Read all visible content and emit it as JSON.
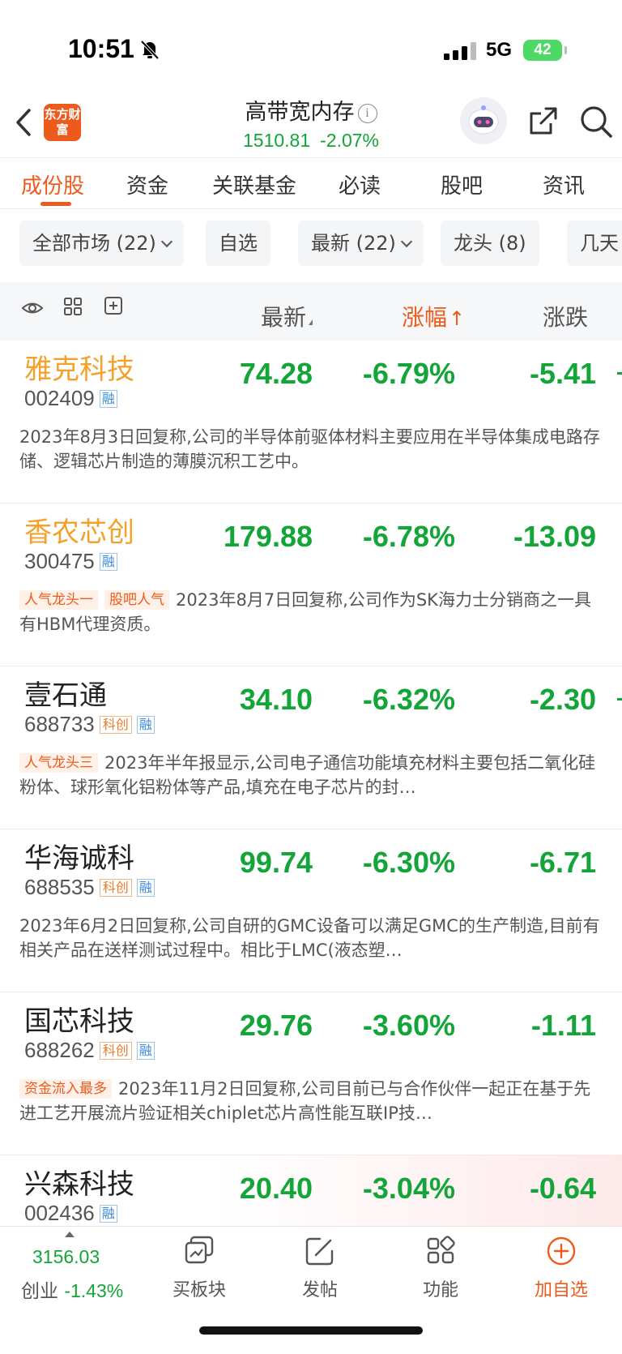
{
  "status": {
    "time": "10:51",
    "network": "5G",
    "battery": "42"
  },
  "header": {
    "logo_text": "东方财富",
    "title": "高带宽内存",
    "info_glyph": "i",
    "price": "1510.81",
    "change_pct": "-2.07%"
  },
  "tabs": [
    "成份股",
    "资金",
    "关联基金",
    "必读",
    "股吧",
    "资讯"
  ],
  "filters": [
    "全部市场 (22)",
    "自选",
    "最新 (22)",
    "龙头 (8)",
    "几天"
  ],
  "columns": {
    "latest": "最新",
    "pct": "涨幅",
    "pct_arrow": "↑",
    "change": "涨跌"
  },
  "stocks": [
    {
      "name": "雅克科技",
      "code": "002409",
      "badges": [
        "融"
      ],
      "price": "74.28",
      "pct": "-6.79%",
      "change": "-5.41",
      "tags": [],
      "desc": "2023年8月3日回复称,公司的半导体前驱体材料主要应用在半导体集成电路存储、逻辑芯片制造的薄膜沉积工艺中。"
    },
    {
      "name": "香农芯创",
      "code": "300475",
      "badges": [
        "融"
      ],
      "price": "179.88",
      "pct": "-6.78%",
      "change": "-13.09",
      "tags": [
        "人气龙头一",
        "股吧人气"
      ],
      "desc": "2023年8月7日回复称,公司作为SK海力士分销商之一具有HBM代理资质。"
    },
    {
      "name": "壹石通",
      "code": "688733",
      "badges": [
        "科创",
        "融"
      ],
      "price": "34.10",
      "pct": "-6.32%",
      "change": "-2.30",
      "tags": [
        "人气龙头三"
      ],
      "desc": "2023年半年报显示,公司电子通信功能填充材料主要包括二氧化硅粉体、球形氧化铝粉体等产品,填充在电子芯片的封…"
    },
    {
      "name": "华海诚科",
      "code": "688535",
      "badges": [
        "科创",
        "融"
      ],
      "price": "99.74",
      "pct": "-6.30%",
      "change": "-6.71",
      "tags": [],
      "desc": "2023年6月2日回复称,公司自研的GMC设备可以满足GMC的生产制造,目前有相关产品在送样测试过程中。相比于LMC(液态塑…"
    },
    {
      "name": "国芯科技",
      "code": "688262",
      "badges": [
        "科创",
        "融"
      ],
      "price": "29.76",
      "pct": "-3.60%",
      "change": "-1.11",
      "tags": [
        "资金流入最多"
      ],
      "desc": "2023年11月2日回复称,公司目前已与合作伙伴一起正在基于先进工艺开展流片验证相关chiplet芯片高性能互联IP技…"
    },
    {
      "name": "兴森科技",
      "code": "002436",
      "badges": [
        "融"
      ],
      "price": "20.40",
      "pct": "-3.04%",
      "change": "-0.64",
      "tags": [],
      "desc": ""
    }
  ],
  "bottom": {
    "index_value": "3156.03",
    "index_name": "创业",
    "index_pct": "-1.43%",
    "nav": [
      "买板块",
      "发帖",
      "功能",
      "加自选"
    ]
  },
  "colors": {
    "accent": "#ec5b1c",
    "down_green": "#13a538",
    "hot_name": "#f3a12b"
  }
}
